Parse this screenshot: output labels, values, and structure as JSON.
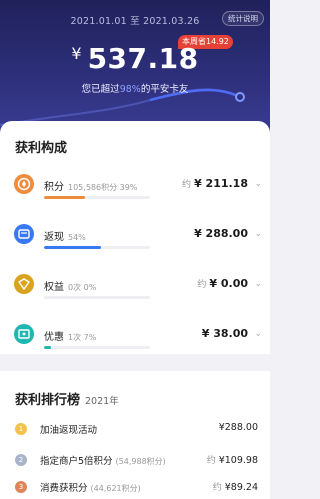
{
  "header": {
    "date_start": "2021.01.01",
    "date_sep": "至",
    "date_end": "2021.03.26",
    "stats_button": "统计说明",
    "week_badge": "本周省14.92",
    "currency": "¥",
    "total_amount": "537.18",
    "rank_prefix": "您已超过",
    "rank_percent": "98%",
    "rank_suffix": "的平安卡友"
  },
  "composition": {
    "title": "获利构成",
    "items": [
      {
        "name": "积分",
        "sub": "105,586积分 39%",
        "approx": "约",
        "value": "¥ 211.18",
        "icon": "points-icon",
        "color": "#f08a3c",
        "fill": 0.39
      },
      {
        "name": "返现",
        "sub": "54%",
        "approx": "",
        "value": "¥ 288.00",
        "icon": "cashback-icon",
        "color": "#3a78f2",
        "fill": 0.54
      },
      {
        "name": "权益",
        "sub": "0次 0%",
        "approx": "约",
        "value": "¥ 0.00",
        "icon": "rights-icon",
        "color": "#d9a21f",
        "fill": 0.0
      },
      {
        "name": "优惠",
        "sub": "1次 7%",
        "approx": "",
        "value": "¥ 38.00",
        "icon": "discount-icon",
        "color": "#1fb7b0",
        "fill": 0.07
      }
    ]
  },
  "ranking": {
    "title": "获利排行榜",
    "year": "2021年",
    "items": [
      {
        "rank": "1",
        "name": "加油返现活动",
        "sub": "",
        "approx": "",
        "value": "¥288.00",
        "medal_color": "#f3c24a"
      },
      {
        "rank": "2",
        "name": "指定商户5倍积分",
        "sub": "(54,988积分)",
        "approx": "约",
        "value": "¥109.98",
        "medal_color": "#a9b4c8"
      },
      {
        "rank": "3",
        "name": "消费获积分",
        "sub": "(44,621积分)",
        "approx": "约",
        "value": "¥89.24",
        "medal_color": "#e0855a"
      }
    ]
  },
  "colors": {
    "hero_dark": "#20215a",
    "hero_light": "#3a3c93",
    "badge_red": "#e64136",
    "accent_purple": "#8fa0ff"
  }
}
